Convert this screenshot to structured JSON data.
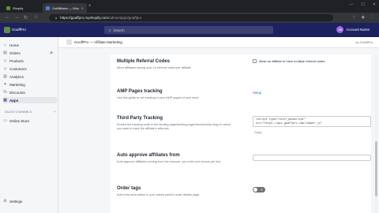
{
  "browser": {
    "tabs": [
      {
        "label": "Shopify",
        "active": false
      },
      {
        "label": "GoAffiliates — WordPress",
        "active": true
      }
    ],
    "new_tab": "+",
    "url_host": "https://goaffpro.myshopify.com",
    "url_path": "/admin/apps/goaffpro"
  },
  "shop": {
    "store_name": "GoaffPro",
    "search_placeholder": "Search",
    "account_initials": "AN",
    "account_name": "Account Name"
  },
  "sidebar": {
    "items": [
      {
        "label": "Home",
        "icon": "home-icon",
        "glyph": "⌂",
        "active": false
      },
      {
        "label": "Orders",
        "icon": "orders-icon",
        "glyph": "▤",
        "active": false,
        "count": "9"
      },
      {
        "label": "Products",
        "icon": "products-icon",
        "glyph": "◇",
        "active": false
      },
      {
        "label": "Customers",
        "icon": "customers-icon",
        "glyph": "☺",
        "active": false
      },
      {
        "label": "Analytics",
        "icon": "analytics-icon",
        "glyph": "▥",
        "active": false
      },
      {
        "label": "Marketing",
        "icon": "marketing-icon",
        "glyph": "✦",
        "active": false
      },
      {
        "label": "Discounts",
        "icon": "discounts-icon",
        "glyph": "%",
        "active": false
      },
      {
        "label": "Apps",
        "icon": "apps-icon",
        "glyph": "▦",
        "active": true
      }
    ],
    "channels_heading": "SALES CHANNELS",
    "channels_add": "+",
    "online_store": "Online Store",
    "settings": "Settings"
  },
  "app": {
    "title": "GoAffPro — Affiliate Marketing",
    "by": "by GoAffPro"
  },
  "settings": [
    {
      "title": "Multiple Referral Codes",
      "desc": "Allow affiliates having upto 10 referral codes per affiliate",
      "control": "checkbox",
      "control_label": "Allow an affiliate to have multiple referral codes"
    },
    {
      "title": "AMP Pages tracking",
      "desc": "Use this guide to set tracking in your AMP pages of your store",
      "control": "link",
      "control_label": "Setup"
    },
    {
      "title": "Third Party Tracking",
      "desc": "Embed the tracking code in the landing page/landing page/membership blog on which you want to track the affiliate's referrals",
      "control": "code",
      "code_line1": "<script type=\"text/javascript\"",
      "code_line2": "src=\"https://api.goaffpro.com/loader.js\"",
      "copy_label": "Copy"
    },
    {
      "title": "Auto approve affiliates from",
      "desc": "Auto approve affiliates coming from the sources, you enter one source per line",
      "control": "textfield"
    },
    {
      "title": "Order tags",
      "desc": "Add extra information in your admin panel's order details page",
      "control": "toggle",
      "toggle_text": "✕",
      "toggle_on": false
    }
  ]
}
